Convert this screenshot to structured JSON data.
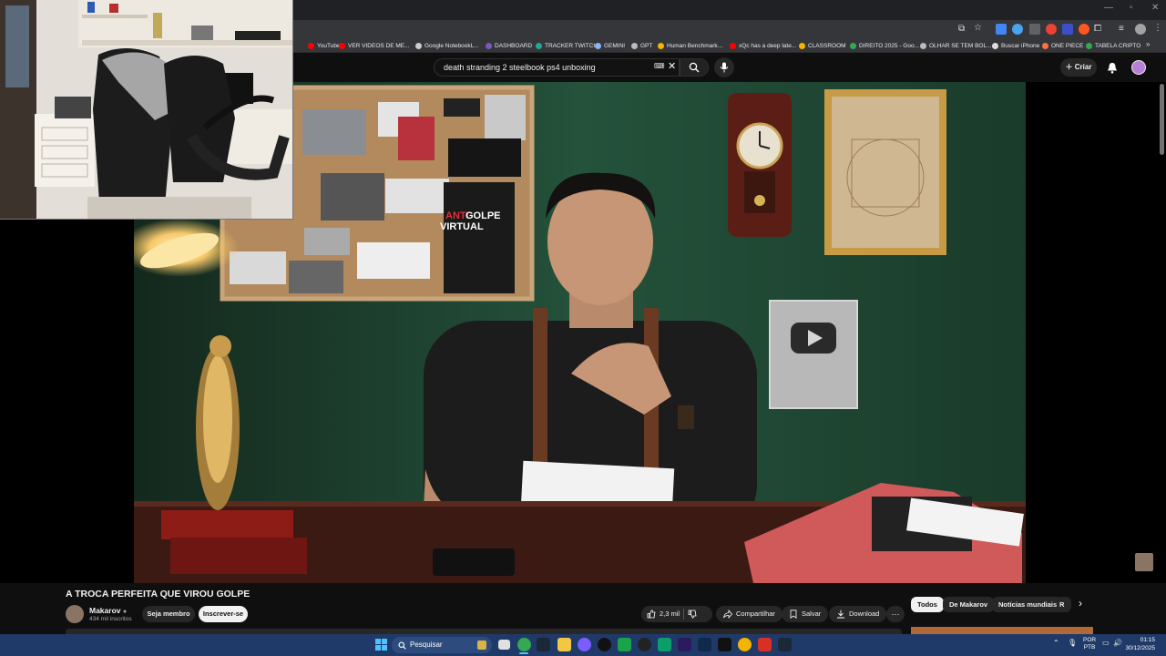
{
  "browser": {
    "bookmarks": [
      {
        "label": "YouTube",
        "color": "#ff0000"
      },
      {
        "label": "VER VIDEOS DE ME...",
        "color": "#ff0000"
      },
      {
        "label": "Google NotebookL...",
        "color": "#cccccc"
      },
      {
        "label": "DASHBOARD",
        "color": "#7e57c2"
      },
      {
        "label": "TRACKER TWITCH",
        "color": "#26a69a"
      },
      {
        "label": "GEMINI",
        "color": "#8ab4f8"
      },
      {
        "label": "GPT",
        "color": "#bbbbbb"
      },
      {
        "label": "Human Benchmark...",
        "color": "#f4b400"
      },
      {
        "label": "xQc has a deep late...",
        "color": "#ff0000"
      },
      {
        "label": "CLASSROOM",
        "color": "#f4b400"
      },
      {
        "label": "DIREITO 2025 - Goo...",
        "color": "#34a853"
      },
      {
        "label": "OLHAR SE TEM BOL...",
        "color": "#bbbbbb"
      },
      {
        "label": "Buscar iPhone",
        "color": "#dddddd"
      },
      {
        "label": "ONE PIECE",
        "color": "#ff7043"
      },
      {
        "label": "TABELA CRIPTO",
        "color": "#34a853"
      }
    ]
  },
  "youtube": {
    "search_query": "death stranding 2 steelbook ps4 unboxing",
    "create_label": "Criar",
    "video": {
      "title": "A TROCA PERFEITA QUE VIROU GOLPE",
      "channel": "Makarov",
      "subscribers": "434 mil inscritos",
      "member_label": "Seja membro",
      "subscribe_label": "Inscrever-se",
      "likes": "2,3 mil",
      "share_label": "Compartilhar",
      "save_label": "Salvar",
      "download_label": "Download"
    },
    "chips": [
      "Todos",
      "De Makarov",
      "Notícias mundiais",
      "R"
    ],
    "poster_text": [
      "ANTI",
      "GOLPE",
      "VIRTUAL"
    ]
  },
  "taskbar": {
    "search_placeholder": "Pesquisar",
    "lang_top": "POR",
    "lang_bottom": "PTB",
    "time": "01:15",
    "date": "30/12/2025"
  }
}
